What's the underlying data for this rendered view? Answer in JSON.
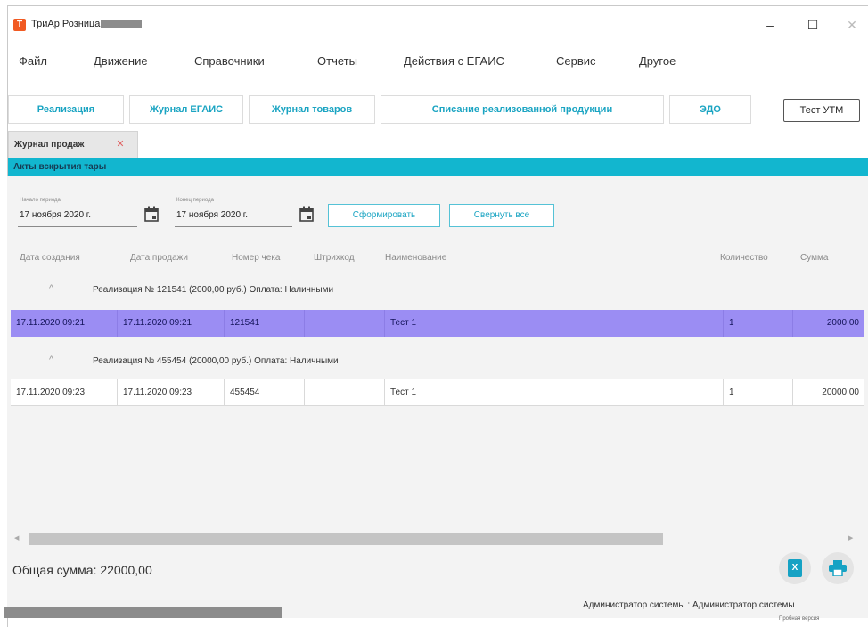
{
  "window": {
    "app_title": "ТриАр Розница",
    "minimize": "–",
    "maximize": "☐",
    "close": "✕"
  },
  "menu": [
    "Файл",
    "Движение",
    "Справочники",
    "Отчеты",
    "Действия с ЕГАИС",
    "Сервис",
    "Другое"
  ],
  "top_tabs": [
    "Реализация",
    "Журнал ЕГАИС",
    "Журнал товаров",
    "Списание реализованной продукции",
    "ЭДО"
  ],
  "test_utm_button": "Тест УТМ",
  "document_tab": {
    "label": "Журнал продаж",
    "close": "✕"
  },
  "section_title": "Акты вскрытия тары",
  "filters": {
    "start_label": "Начало периода",
    "start_value": "17 ноября 2020 г.",
    "end_label": "Конец периода",
    "end_value": "17 ноября 2020 г.",
    "generate_button": "Сформировать",
    "collapse_button": "Свернуть все"
  },
  "table": {
    "columns": [
      "Дата создания",
      "Дата продажи",
      "Номер чека",
      "Штрихкод",
      "Наименование",
      "Количество",
      "Сумма"
    ],
    "groups": [
      {
        "chevron": "^",
        "title": "Реализация № 121541 (2000,00 руб.) Оплата: Наличными",
        "row": {
          "created": "17.11.2020 09:21",
          "sold": "17.11.2020 09:21",
          "receipt": "121541",
          "barcode": "",
          "name": "Тест 1",
          "qty": "1",
          "sum": "2000,00"
        }
      },
      {
        "chevron": "^",
        "title": "Реализация № 455454 (20000,00 руб.) Оплата: Наличными",
        "row": {
          "created": "17.11.2020 09:23",
          "sold": "17.11.2020 09:23",
          "receipt": "455454",
          "barcode": "",
          "name": "Тест 1",
          "qty": "1",
          "sum": "20000,00"
        }
      }
    ]
  },
  "footer": {
    "total": "Общая сумма: 22000,00",
    "excel_icon_letter": "X"
  },
  "status": {
    "user": "Администратор системы : Администратор системы",
    "trial": "Пробная версия"
  },
  "colors": {
    "accent": "#12b6cf",
    "tab_text": "#1aa4c2",
    "selected_row": "#9b8df3",
    "logo": "#f15a22"
  }
}
